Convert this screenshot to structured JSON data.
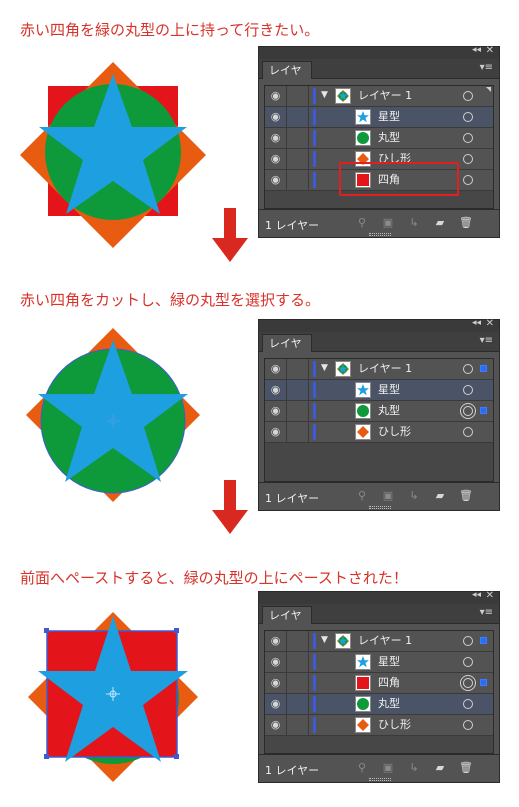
{
  "captions": {
    "step1": "赤い四角を緑の丸型の上に持って行きたい。",
    "step2": "赤い四角をカットし、緑の丸型を選択する。",
    "step3": "前面へペーストすると、緑の丸型の上にペーストされた！"
  },
  "colors": {
    "red_square": "#e3151b",
    "orange_diamond": "#e85c12",
    "green_circle": "#0e9a3a",
    "blue_star": "#1e9fe0",
    "caption_red": "#d8322a",
    "arrow_red": "#d9281f",
    "selection_blue": "#3d5bd6"
  },
  "panels": [
    {
      "tab_label": "レイヤー",
      "layer_count": "1 レイヤー",
      "rows": [
        {
          "label": "レイヤー 1",
          "thumb": "layer-thumb",
          "selected": false,
          "expand": "▼",
          "target": "single",
          "selsq": false
        },
        {
          "label": "星型",
          "thumb": "star",
          "selected": true,
          "target": "single",
          "selsq": false
        },
        {
          "label": "丸型",
          "thumb": "circle",
          "selected": false,
          "target": "single",
          "selsq": false
        },
        {
          "label": "ひし形",
          "thumb": "diamond",
          "selected": false,
          "target": "single",
          "selsq": false
        },
        {
          "label": "四角",
          "thumb": "square",
          "selected": false,
          "target": "single",
          "selsq": false
        }
      ]
    },
    {
      "tab_label": "レイヤー",
      "layer_count": "1 レイヤー",
      "rows": [
        {
          "label": "レイヤー 1",
          "thumb": "layer-thumb",
          "selected": false,
          "expand": "▼",
          "target": "single",
          "selsq": true
        },
        {
          "label": "星型",
          "thumb": "star",
          "selected": true,
          "target": "single",
          "selsq": false
        },
        {
          "label": "丸型",
          "thumb": "circle",
          "selected": false,
          "target": "double",
          "selsq": true
        },
        {
          "label": "ひし形",
          "thumb": "diamond",
          "selected": false,
          "target": "single",
          "selsq": false
        }
      ]
    },
    {
      "tab_label": "レイヤー",
      "layer_count": "1 レイヤー",
      "rows": [
        {
          "label": "レイヤー 1",
          "thumb": "layer-thumb",
          "selected": false,
          "expand": "▼",
          "target": "single",
          "selsq": true
        },
        {
          "label": "星型",
          "thumb": "star",
          "selected": false,
          "target": "single",
          "selsq": false
        },
        {
          "label": "四角",
          "thumb": "square",
          "selected": false,
          "target": "double",
          "selsq": true
        },
        {
          "label": "丸型",
          "thumb": "circle",
          "selected": true,
          "target": "single",
          "selsq": false
        },
        {
          "label": "ひし形",
          "thumb": "diamond",
          "selected": false,
          "target": "single",
          "selsq": false
        }
      ]
    }
  ],
  "icons": {
    "eye": "eye-icon",
    "collapse": "double-chevron-left-icon",
    "close": "close-icon",
    "menu": "panel-menu-icon",
    "footer": [
      "search-icon",
      "clipping-mask-icon",
      "sublayer-icon",
      "new-layer-icon",
      "trash-icon"
    ]
  }
}
